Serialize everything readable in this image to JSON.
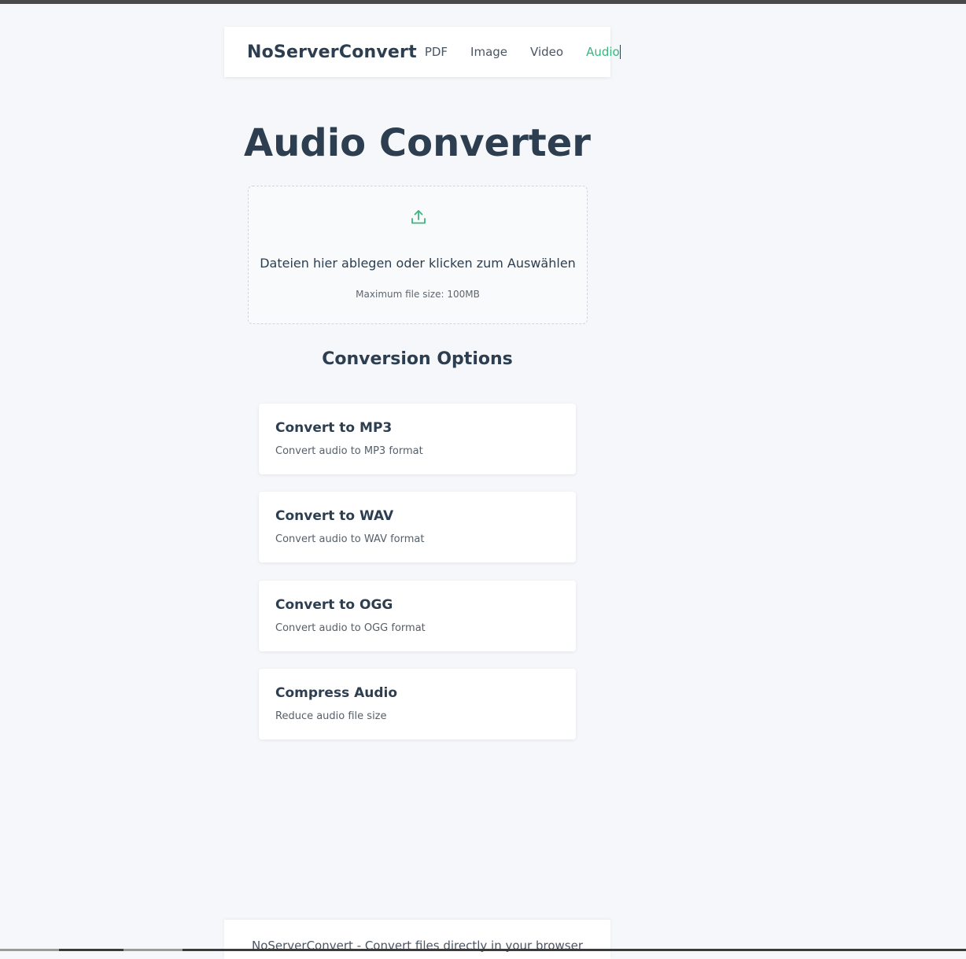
{
  "header": {
    "brand": "NoServerConvert",
    "nav": [
      "PDF",
      "Image",
      "Video",
      "Audio"
    ],
    "active_nav": "Audio"
  },
  "main": {
    "title": "Audio Converter",
    "drop_zone": {
      "icon": "upload-icon",
      "text": "Dateien hier ablegen oder klicken zum Auswählen",
      "hint": "Maximum file size: 100MB"
    },
    "options_title": "Conversion Options",
    "options": [
      {
        "title": "Convert to MP3",
        "desc": "Convert audio to MP3 format"
      },
      {
        "title": "Convert to WAV",
        "desc": "Convert audio to WAV format"
      },
      {
        "title": "Convert to OGG",
        "desc": "Convert audio to OGG format"
      },
      {
        "title": "Compress Audio",
        "desc": "Reduce audio file size"
      }
    ]
  },
  "footer": {
    "text": "NoServerConvert - Convert files directly in your browser"
  },
  "colors": {
    "accent": "#3ab57f",
    "text_dark": "#2c3e50",
    "background": "#f5f7fa"
  }
}
